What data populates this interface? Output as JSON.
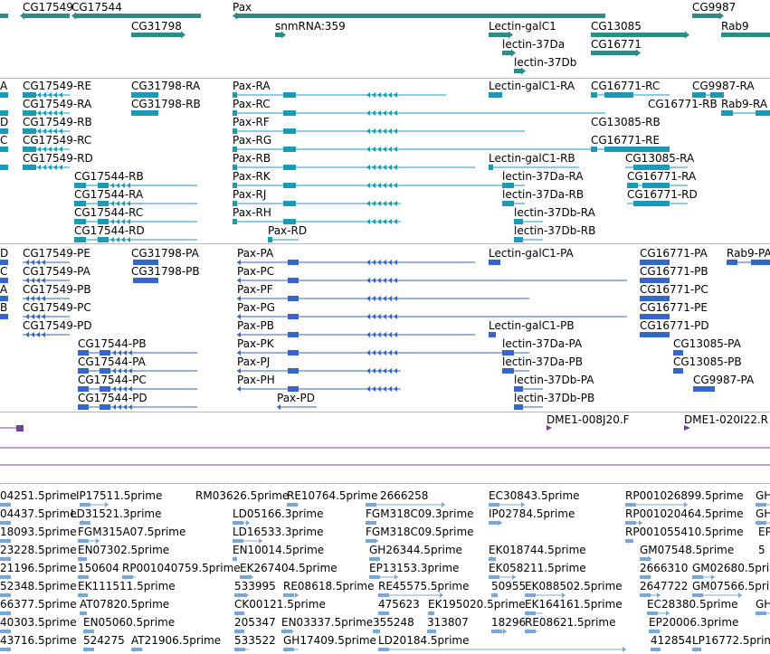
{
  "colors": {
    "gene": "#2e8b8b",
    "mrna": "#1a9ab8",
    "protein": "#3366cc",
    "ests": "#79a8d4",
    "clone": "#7040a0",
    "divider": "#b8b8b8"
  },
  "tracks": [
    {
      "name": "genes",
      "color_key": "gene"
    },
    {
      "name": "mrnas",
      "color_key": "mrna"
    },
    {
      "name": "proteins",
      "color_key": "protein"
    },
    {
      "name": "clones",
      "color_key": "clone"
    },
    {
      "name": "ests",
      "color_key": "ests"
    }
  ],
  "genes": [
    {
      "label": "CG17549"
    },
    {
      "label": "CG17544"
    },
    {
      "label": "Pax"
    },
    {
      "label": "CG9987"
    },
    {
      "label": "CG31798"
    },
    {
      "label": "snmRNA:359"
    },
    {
      "label": "Lectin-galC1"
    },
    {
      "label": "CG13085"
    },
    {
      "label": "Rab9"
    },
    {
      "label": "lectin-37Da"
    },
    {
      "label": "CG16771"
    },
    {
      "label": "lectin-37Db"
    }
  ],
  "mrnas": [
    {
      "label": "A"
    },
    {
      "label": "CG17549-RE"
    },
    {
      "label": "CG31798-RA"
    },
    {
      "label": "Pax-RA"
    },
    {
      "label": "Lectin-galC1-RA"
    },
    {
      "label": "CG16771-RC"
    },
    {
      "label": "CG9987-RA"
    },
    {
      "label": "CG17549-RA"
    },
    {
      "label": "CG31798-RB"
    },
    {
      "label": "Pax-RC"
    },
    {
      "label": "CG16771-RB"
    },
    {
      "label": "Rab9-RA"
    },
    {
      "label": "D"
    },
    {
      "label": "CG17549-RB"
    },
    {
      "label": "Pax-RF"
    },
    {
      "label": "CG13085-RB"
    },
    {
      "label": "C"
    },
    {
      "label": "CG17549-RC"
    },
    {
      "label": "Pax-RG"
    },
    {
      "label": "CG16771-RE"
    },
    {
      "label": "CG17549-RD"
    },
    {
      "label": "Pax-RB"
    },
    {
      "label": "Lectin-galC1-RB"
    },
    {
      "label": "CG13085-RA"
    },
    {
      "label": "CG17544-RB"
    },
    {
      "label": "Pax-RK"
    },
    {
      "label": "lectin-37Da-RA"
    },
    {
      "label": "CG16771-RA"
    },
    {
      "label": "CG17544-RA"
    },
    {
      "label": "Pax-RJ"
    },
    {
      "label": "lectin-37Da-RB"
    },
    {
      "label": "CG16771-RD"
    },
    {
      "label": "CG17544-RC"
    },
    {
      "label": "Pax-RH"
    },
    {
      "label": "lectin-37Db-RA"
    },
    {
      "label": "CG17544-RD"
    },
    {
      "label": "Pax-RD"
    },
    {
      "label": "lectin-37Db-RB"
    }
  ],
  "proteins": [
    {
      "label": "D"
    },
    {
      "label": "CG17549-PE"
    },
    {
      "label": "CG31798-PA"
    },
    {
      "label": "Pax-PA"
    },
    {
      "label": "Lectin-galC1-PA"
    },
    {
      "label": "CG16771-PA"
    },
    {
      "label": "Rab9-PA"
    },
    {
      "label": "C"
    },
    {
      "label": "CG17549-PA"
    },
    {
      "label": "CG31798-PB"
    },
    {
      "label": "Pax-PC"
    },
    {
      "label": "CG16771-PB"
    },
    {
      "label": "A"
    },
    {
      "label": "CG17549-PB"
    },
    {
      "label": "Pax-PF"
    },
    {
      "label": "CG16771-PC"
    },
    {
      "label": "B"
    },
    {
      "label": "CG17549-PC"
    },
    {
      "label": "Pax-PG"
    },
    {
      "label": "CG16771-PE"
    },
    {
      "label": "CG17549-PD"
    },
    {
      "label": "Pax-PB"
    },
    {
      "label": "Lectin-galC1-PB"
    },
    {
      "label": "CG16771-PD"
    },
    {
      "label": "CG17544-PB"
    },
    {
      "label": "Pax-PK"
    },
    {
      "label": "lectin-37Da-PA"
    },
    {
      "label": "CG13085-PA"
    },
    {
      "label": "CG17544-PA"
    },
    {
      "label": "Pax-PJ"
    },
    {
      "label": "lectin-37Da-PB"
    },
    {
      "label": "CG13085-PB"
    },
    {
      "label": "CG17544-PC"
    },
    {
      "label": "Pax-PH"
    },
    {
      "label": "lectin-37Db-PA"
    },
    {
      "label": "CG9987-PA"
    },
    {
      "label": "CG17544-PD"
    },
    {
      "label": "Pax-PD"
    },
    {
      "label": "lectin-37Db-PB"
    }
  ],
  "clones": [
    {
      "label": "DME1-008J20.F"
    },
    {
      "label": "DME1-020I22.R"
    }
  ],
  "ests": [
    {
      "label": "04251.5prime"
    },
    {
      "label": "IP17511.5prime"
    },
    {
      "label": "RM03626.5prime"
    },
    {
      "label": "RE10764.5prime"
    },
    {
      "label": "2666258"
    },
    {
      "label": "EC30843.5prime"
    },
    {
      "label": "RP001026899.5prime"
    },
    {
      "label": "GH"
    },
    {
      "label": "04437.5prime"
    },
    {
      "label": "LD31521.3prime"
    },
    {
      "label": "LD05166.3prime"
    },
    {
      "label": "FGM318C09.3prime"
    },
    {
      "label": "IP02784.5prime"
    },
    {
      "label": "RP001020464.5prime"
    },
    {
      "label": "GH"
    },
    {
      "label": "18093.5prime"
    },
    {
      "label": "FGM315A07.5prime"
    },
    {
      "label": "LD16533.3prime"
    },
    {
      "label": "FGM318C09.5prime"
    },
    {
      "label": "RP001055410.5prime"
    },
    {
      "label": "EP"
    },
    {
      "label": "23228.5prime"
    },
    {
      "label": "EN07302.5prime"
    },
    {
      "label": "EN10014.5prime"
    },
    {
      "label": "GH26344.5prime"
    },
    {
      "label": "EK018744.5prime"
    },
    {
      "label": "GM07548.5prime"
    },
    {
      "label": "5"
    },
    {
      "label": "21196.5prime"
    },
    {
      "label": "150604"
    },
    {
      "label": "RP001040759.5prime"
    },
    {
      "label": "EK267404.5prime"
    },
    {
      "label": "EP13153.3prime"
    },
    {
      "label": "EK058211.5prime"
    },
    {
      "label": "2666310"
    },
    {
      "label": "GM02680.5prime"
    },
    {
      "label": "52348.5prime"
    },
    {
      "label": "EK111511.5prime"
    },
    {
      "label": "533995"
    },
    {
      "label": "RE08618.5prime"
    },
    {
      "label": "RE45575.5prime"
    },
    {
      "label": "50955"
    },
    {
      "label": "EK088502.5prime"
    },
    {
      "label": "2647722"
    },
    {
      "label": "GM07566.5prime"
    },
    {
      "label": "66377.5prime"
    },
    {
      "label": "AT07820.5prime"
    },
    {
      "label": "CK00121.5prime"
    },
    {
      "label": "475623"
    },
    {
      "label": "EK195020.5prime"
    },
    {
      "label": "EK164161.5prime"
    },
    {
      "label": "EC28380.5prime"
    },
    {
      "label": "GH"
    },
    {
      "label": "40303.5prime"
    },
    {
      "label": "EN05060.5prime"
    },
    {
      "label": "205347"
    },
    {
      "label": "EN03337.5prime"
    },
    {
      "label": "355248"
    },
    {
      "label": "313807"
    },
    {
      "label": "18296"
    },
    {
      "label": "RE08621.5prime"
    },
    {
      "label": "EP20006.3prime"
    },
    {
      "label": "43716.5prime"
    },
    {
      "label": "524275"
    },
    {
      "label": "AT21906.5prime"
    },
    {
      "label": "533522"
    },
    {
      "label": "GH17409.5prime"
    },
    {
      "label": "LD20184.5prime"
    },
    {
      "label": "412854"
    },
    {
      "label": "LP16772.5prime"
    }
  ]
}
